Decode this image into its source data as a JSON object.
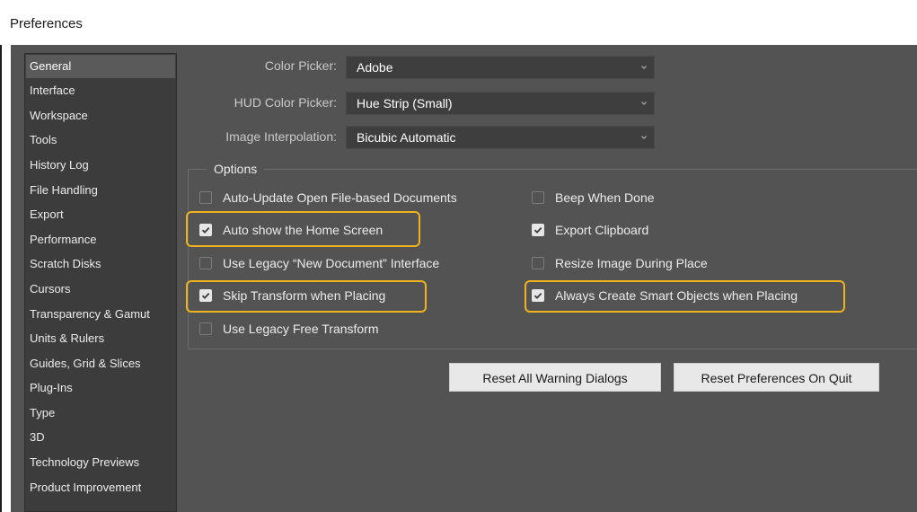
{
  "window": {
    "title": "Preferences"
  },
  "sidebar": {
    "items": [
      {
        "label": "General",
        "selected": true
      },
      {
        "label": "Interface"
      },
      {
        "label": "Workspace"
      },
      {
        "label": "Tools"
      },
      {
        "label": "History Log"
      },
      {
        "label": "File Handling"
      },
      {
        "label": "Export"
      },
      {
        "label": "Performance"
      },
      {
        "label": "Scratch Disks"
      },
      {
        "label": "Cursors"
      },
      {
        "label": "Transparency & Gamut"
      },
      {
        "label": "Units & Rulers"
      },
      {
        "label": "Guides, Grid & Slices"
      },
      {
        "label": "Plug-Ins"
      },
      {
        "label": "Type"
      },
      {
        "label": "3D"
      },
      {
        "label": "Technology Previews"
      },
      {
        "label": "Product Improvement"
      }
    ]
  },
  "fields": {
    "color_picker": {
      "label": "Color Picker:",
      "value": "Adobe"
    },
    "hud_color_picker": {
      "label": "HUD Color Picker:",
      "value": "Hue Strip (Small)"
    },
    "image_interpolation": {
      "label": "Image Interpolation:",
      "value": "Bicubic Automatic"
    }
  },
  "options": {
    "legend": "Options",
    "left": [
      {
        "label": "Auto-Update Open File-based Documents",
        "checked": false
      },
      {
        "label": "Auto show the Home Screen",
        "checked": true,
        "highlighted": true
      },
      {
        "label": "Use Legacy “New Document” Interface",
        "checked": false
      },
      {
        "label": "Skip Transform when Placing",
        "checked": true,
        "highlighted": true
      },
      {
        "label": "Use Legacy Free Transform",
        "checked": false
      }
    ],
    "right": [
      {
        "label": "Beep When Done",
        "checked": false
      },
      {
        "label": "Export Clipboard",
        "checked": true
      },
      {
        "label": "Resize Image During Place",
        "checked": false
      },
      {
        "label": "Always Create Smart Objects when Placing",
        "checked": true,
        "highlighted": true
      }
    ]
  },
  "buttons": {
    "reset_warnings": "Reset All Warning Dialogs",
    "reset_prefs": "Reset Preferences On Quit"
  },
  "colors": {
    "highlight": "#f0b21d",
    "panel": "#535353",
    "sidebar": "#3c3c3c"
  }
}
